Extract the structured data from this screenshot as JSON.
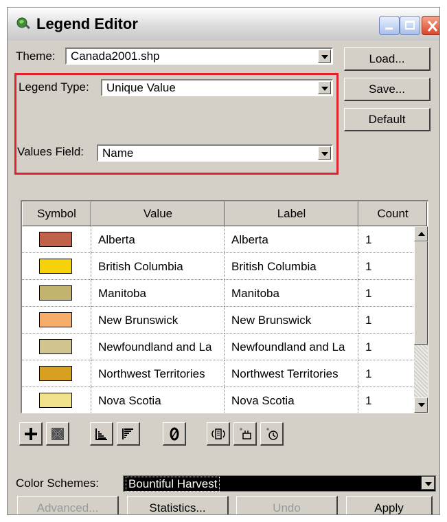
{
  "window": {
    "title": "Legend Editor"
  },
  "theme": {
    "label": "Theme:",
    "value": "Canada2001.shp"
  },
  "legend_type": {
    "label": "Legend Type:",
    "value": "Unique Value"
  },
  "values_field": {
    "label": "Values Field:",
    "value": "Name"
  },
  "side_buttons": {
    "load": "Load...",
    "save": "Save...",
    "default": "Default"
  },
  "table": {
    "columns": [
      "Symbol",
      "Value",
      "Label",
      "Count"
    ],
    "rows": [
      {
        "color": "#c0614a",
        "value": "Alberta",
        "label": "Alberta",
        "count": "1"
      },
      {
        "color": "#f5d20a",
        "value": "British Columbia",
        "label": "British Columbia",
        "count": "1"
      },
      {
        "color": "#c2b46e",
        "value": "Manitoba",
        "label": "Manitoba",
        "count": "1"
      },
      {
        "color": "#f7ad6a",
        "value": "New Brunswick",
        "label": "New Brunswick",
        "count": "1"
      },
      {
        "color": "#d2c48e",
        "value": "Newfoundland and La",
        "label": "Newfoundland and La",
        "count": "1"
      },
      {
        "color": "#d8a020",
        "value": "Northwest Territories",
        "label": "Northwest Territories",
        "count": "1"
      },
      {
        "color": "#f0e28a",
        "value": "Nova Scotia",
        "label": "Nova Scotia",
        "count": "1"
      }
    ]
  },
  "toolbar_icons": [
    "add-icon",
    "delete-icon",
    "sort-ascending-icon",
    "sort-descending-icon",
    "null-value-icon",
    "flip-colors-icon",
    "symbol-select-icon",
    "undo-history-icon"
  ],
  "color_schemes": {
    "label": "Color Schemes:",
    "value": "Bountiful Harvest"
  },
  "bottom_buttons": {
    "advanced": "Advanced...",
    "statistics": "Statistics...",
    "undo": "Undo",
    "apply": "Apply"
  },
  "colors": {
    "highlight": "#e0202a",
    "scheme_bg": "#000000",
    "dialog_bg": "#d4d0c8"
  }
}
